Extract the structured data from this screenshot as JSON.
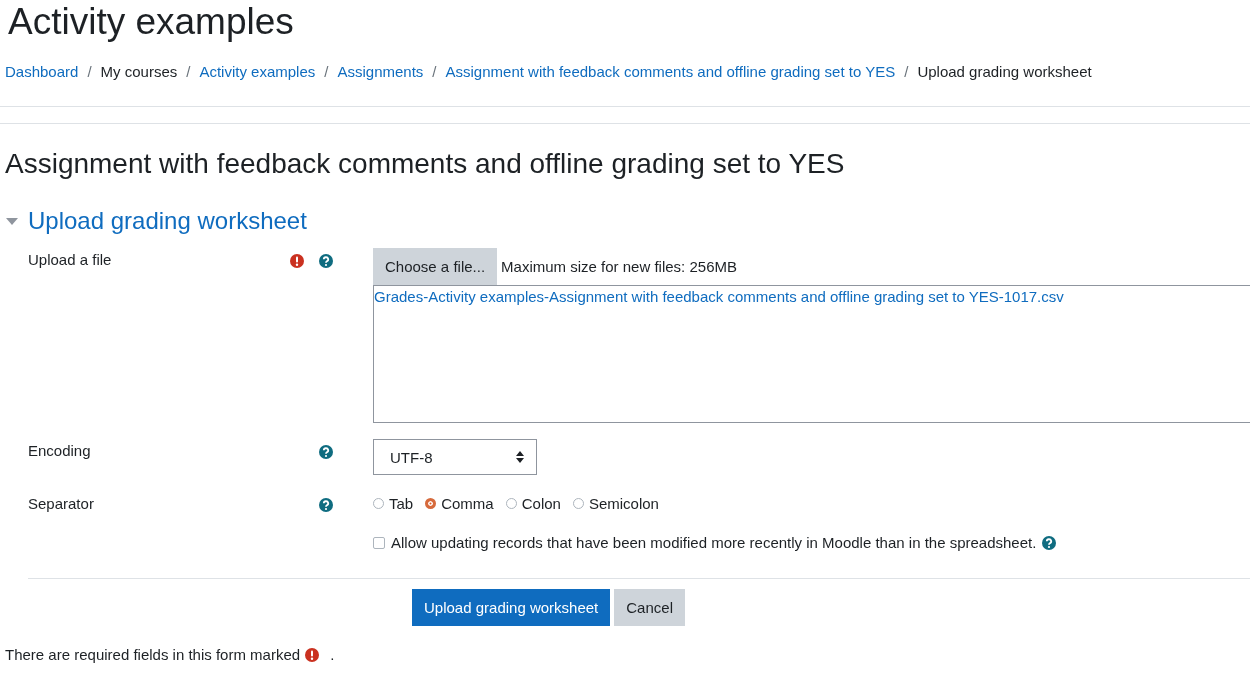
{
  "page_title": "Activity examples",
  "breadcrumbs": [
    {
      "label": "Dashboard",
      "link": true
    },
    {
      "separator": "/",
      "label": "My courses",
      "link": false
    },
    {
      "separator": "/",
      "label": "Activity examples",
      "link": true
    },
    {
      "separator": "/",
      "label": "Assignments",
      "link": true
    },
    {
      "separator": "/",
      "label": "Assignment with feedback comments and offline grading set to YES",
      "link": true
    },
    {
      "separator": "/",
      "label": "Upload grading worksheet",
      "link": false
    }
  ],
  "heading": "Assignment with feedback comments and offline grading set to YES",
  "section": {
    "title": "Upload grading worksheet",
    "expanded": true
  },
  "fields": [
    {
      "kind": "file",
      "label": "Upload a file",
      "required": true,
      "help": true,
      "button": "Choose a file...",
      "note": "Maximum size for new files: 256MB",
      "files": [
        "Grades-Activity examples-Assignment with feedback comments and offline grading set to YES-1017.csv"
      ]
    },
    {
      "kind": "select",
      "label": "Encoding",
      "required": false,
      "help": true,
      "value": "UTF-8"
    },
    {
      "kind": "radios",
      "label": "Separator",
      "required": false,
      "help": true,
      "options": [
        {
          "label": "Tab",
          "selected": false
        },
        {
          "label": "Comma",
          "selected": true
        },
        {
          "label": "Colon",
          "selected": false
        },
        {
          "label": "Semicolon",
          "selected": false
        }
      ]
    },
    {
      "kind": "checkbox",
      "label": "Allow updating records that have been modified more recently in Moodle than in the spreadsheet.",
      "checked": false,
      "help": true
    }
  ],
  "buttons": [
    {
      "label": "Upload grading worksheet",
      "kind": "primary"
    },
    {
      "label": "Cancel",
      "kind": "secondary"
    }
  ],
  "footer": {
    "before": "There are required fields in this form marked",
    "after": "."
  }
}
